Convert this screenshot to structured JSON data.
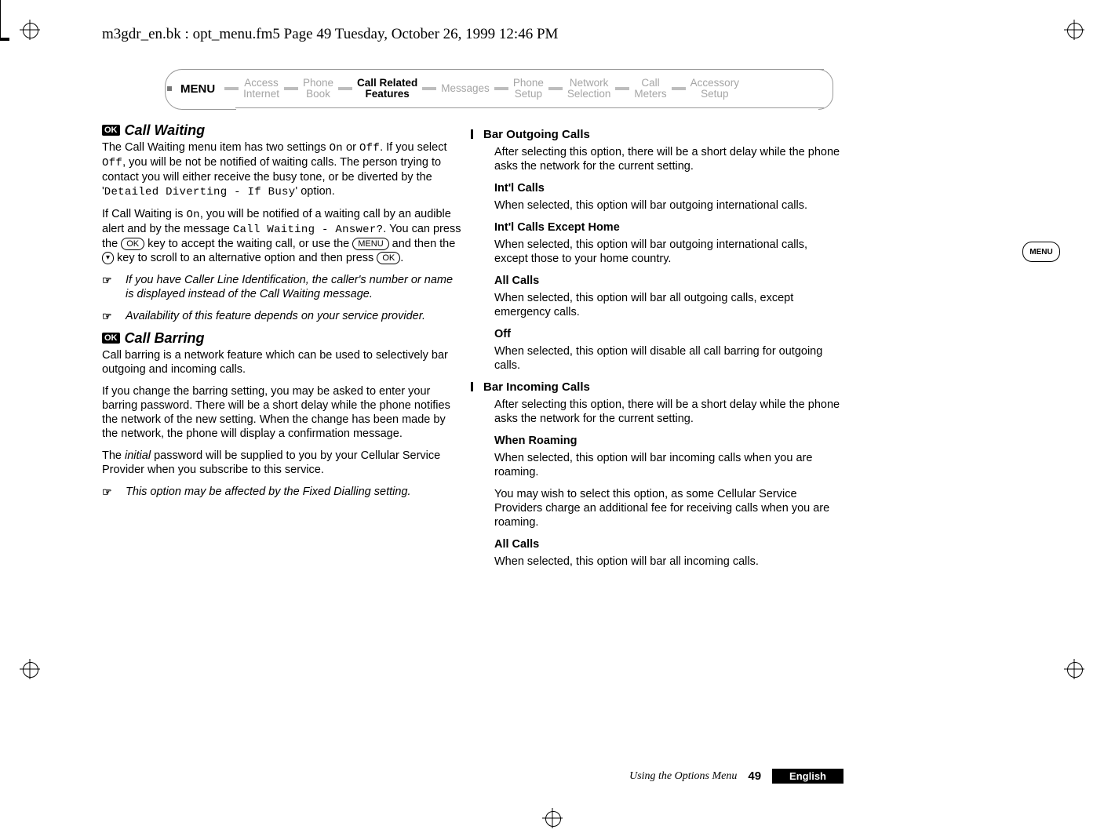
{
  "header_line": "m3gdr_en.bk : opt_menu.fm5  Page 49  Tuesday, October 26, 1999  12:46 PM",
  "menubar": {
    "title_label": "MENU",
    "items": [
      {
        "line1": "Access",
        "line2": "Internet",
        "current": false
      },
      {
        "line1": "Phone",
        "line2": "Book",
        "current": false
      },
      {
        "line1": "Call Related",
        "line2": "Features",
        "current": true
      },
      {
        "line1": "Messages",
        "line2": "",
        "current": false
      },
      {
        "line1": "Phone",
        "line2": "Setup",
        "current": false
      },
      {
        "line1": "Network",
        "line2": "Selection",
        "current": false
      },
      {
        "line1": "Call",
        "line2": "Meters",
        "current": false
      },
      {
        "line1": "Accessory",
        "line2": "Setup",
        "current": false
      }
    ]
  },
  "keys": {
    "ok": "OK",
    "menu": "MENU",
    "down": "▾"
  },
  "ok_badge": "OK",
  "pointer": "☞",
  "content": {
    "s1_title": "Call Waiting",
    "s1_p1a": "The Call Waiting menu item has two settings ",
    "s1_p1_on": "On",
    "s1_p1b": " or ",
    "s1_p1_off": "Off",
    "s1_p1c": ". If you select ",
    "s1_p1_off2": "Off",
    "s1_p1d": ", you will be not be notified of waiting calls. The person trying to contact you will either receive the busy tone, or be diverted by the '",
    "s1_p1_detailed": "Detailed Diverting - If Busy",
    "s1_p1e": "' option.",
    "s1_p2a": "If Call Waiting is ",
    "s1_p2_on": "On",
    "s1_p2b": ", you will be notified of a waiting call by an audible alert and by the message ",
    "s1_p2_msg": "Call Waiting - Answer?",
    "s1_p2c": ". You can press the ",
    "s1_p2d": " key to accept the waiting call, or use the ",
    "s1_p2e": " and then the ",
    "s1_p2f": " key to scroll to an alternative option and then press ",
    "s1_p2g": ".",
    "s1_note1": "If you have Caller Line Identification, the caller's number or name is displayed instead of the Call Waiting message.",
    "s1_note2": "Availability of this feature depends on your service provider.",
    "s2_title": "Call Barring",
    "s2_p1": "Call barring is a network feature which can be used to selectively bar outgoing and incoming calls.",
    "s2_p2": "If you change the barring setting, you may be asked to enter your barring password. There will be a short delay while the phone notifies the network of the new setting. When the change has been made by the network, the phone will display a confirmation message.",
    "s2_p3a": "The ",
    "s2_p3_em": "initial",
    "s2_p3b": " password will be supplied to you by your Cellular Service Provider when you subscribe to this service.",
    "s2_note": "This option may be affected by the Fixed Dialling setting.",
    "r1_h": "Bar Outgoing Calls",
    "r1_p": "After selecting this option, there will be a short delay while the phone asks the network for the current setting.",
    "r1a_h": "Int'l Calls",
    "r1a_p": "When selected, this option will bar outgoing international calls.",
    "r1b_h": "Int'l Calls Except Home",
    "r1b_p": "When selected, this option will bar outgoing international calls, except those to your home country.",
    "r1c_h": "All Calls",
    "r1c_p": "When selected, this option will bar all outgoing calls, except emergency calls.",
    "r1d_h": "Off",
    "r1d_p": "When selected, this option will disable all call barring for outgoing calls.",
    "r2_h": "Bar Incoming Calls",
    "r2_p": "After selecting this option, there will be a short delay while the phone asks the network for the current setting.",
    "r2a_h": "When Roaming",
    "r2a_p1": "When selected, this option will bar incoming calls when you are roaming.",
    "r2a_p2": "You may wish to select this option, as some Cellular Service Providers charge an additional fee for receiving calls when you are roaming.",
    "r2b_h": "All Calls",
    "r2b_p": "When selected, this option will bar all incoming calls."
  },
  "footer": {
    "section_label": "Using the Options Menu",
    "page_num": "49",
    "language": "English"
  },
  "side_menu_label": "MENU"
}
